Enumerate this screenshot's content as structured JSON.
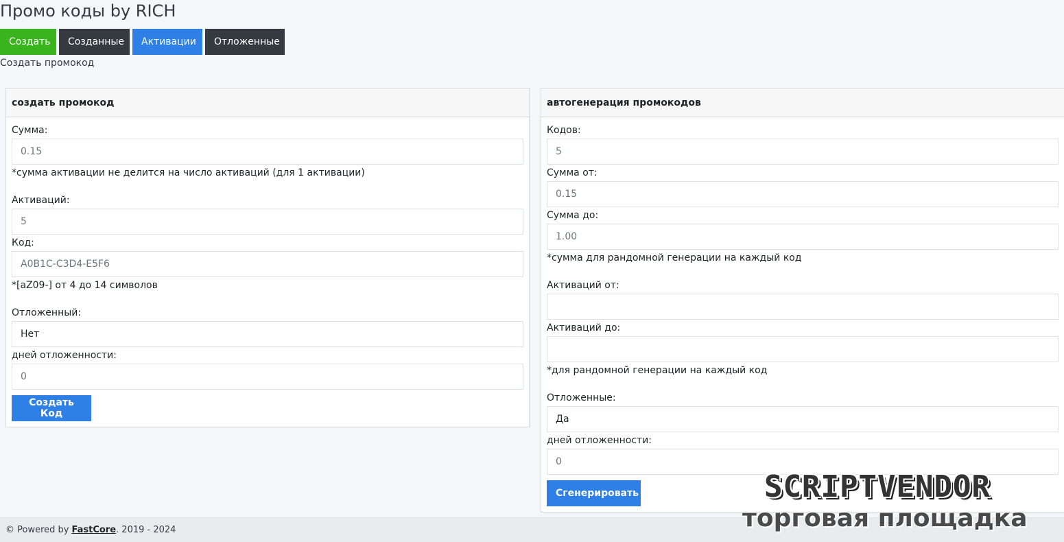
{
  "title": "Промо коды by RICH",
  "tabs": [
    {
      "label": "Создать",
      "color": "#3ab41c"
    },
    {
      "label": "Созданные",
      "color": "#343a40"
    },
    {
      "label": "Активации",
      "color": "#2f80e6"
    },
    {
      "label": "Отложенные",
      "color": "#343a40"
    }
  ],
  "subtitle": "Создать промокод",
  "create": {
    "header": "создать промокод",
    "sum_label": "Сумма:",
    "sum_value": "0.15",
    "sum_hint": "*сумма активации не делится на число активаций (для 1 активации)",
    "activations_label": "Активаций:",
    "activations_value": "5",
    "code_label": "Код:",
    "code_placeholder": "A0B1C-C3D4-E5F6",
    "code_hint": "*[aZ09-] от 4 до 14 символов",
    "deferred_label": "Отложенный:",
    "deferred_value": "Нет",
    "days_label": "дней отложенности:",
    "days_value": "0",
    "submit": "Создать Код"
  },
  "autogen": {
    "header": "автогенерация промокодов",
    "codes_label": "Кодов:",
    "codes_value": "5",
    "sum_from_label": "Сумма от:",
    "sum_from_value": "0.15",
    "sum_to_label": "Сумма до:",
    "sum_to_value": "1.00",
    "sum_hint": "*сумма для рандомной генерации на каждый код",
    "act_from_label": "Активаций от:",
    "act_from_value": "",
    "act_to_label": "Активаций до:",
    "act_to_value": "",
    "act_hint": "*для рандомной генерации на каждый код",
    "deferred_label": "Отложенные:",
    "deferred_value": "Да",
    "days_label": "дней отложенности:",
    "days_value": "0",
    "submit": "Сгенерировать"
  },
  "footer": {
    "prefix": "© Powered by",
    "link": "FastCore",
    "suffix": ". 2019 - 2024"
  },
  "watermark": {
    "top": "SCRIPTVENDOR",
    "bottom": "торговая площадка"
  }
}
